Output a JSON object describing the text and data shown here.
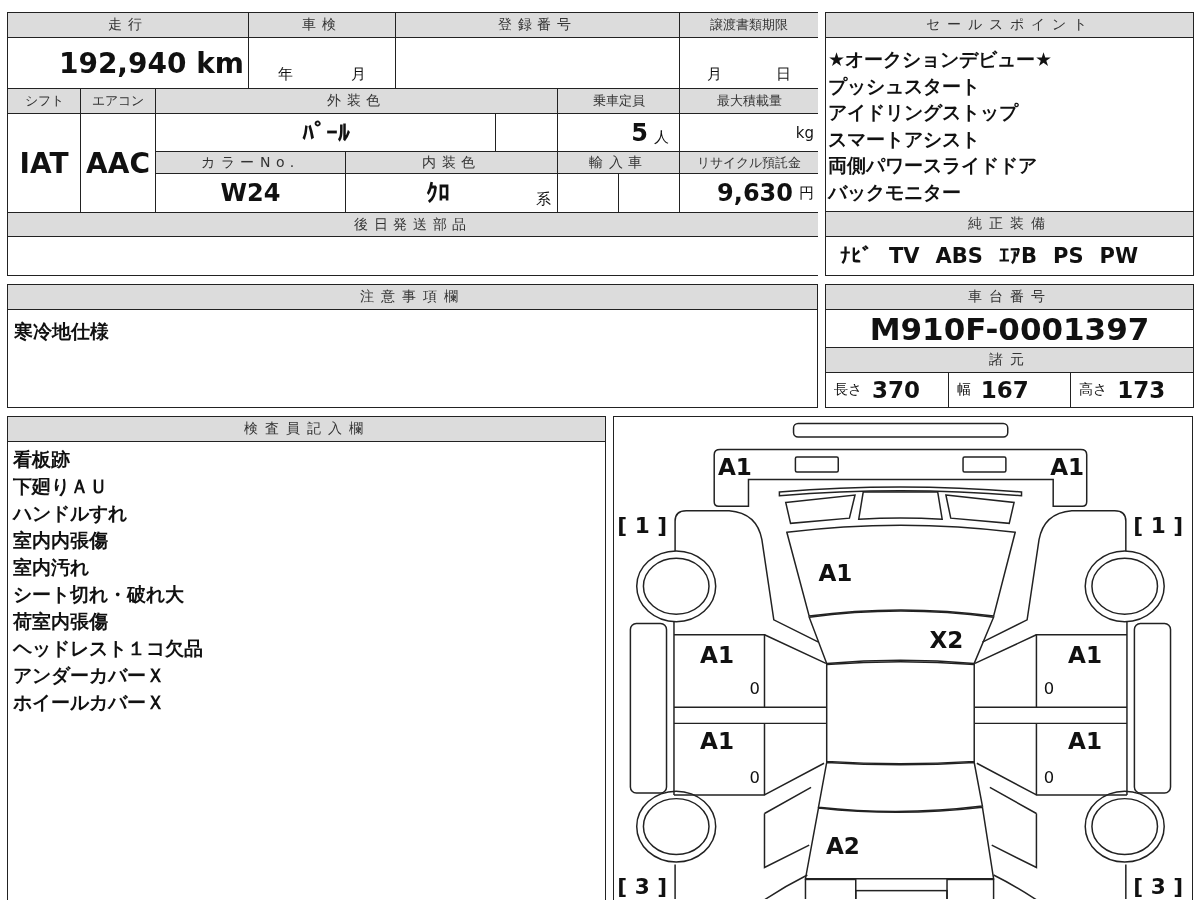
{
  "mileage": {
    "label": "走行",
    "value": "192,940 km"
  },
  "inspection": {
    "label": "車検",
    "year": "年",
    "month": "月"
  },
  "registration": {
    "label": "登録番号"
  },
  "transfer_deadline": {
    "label": "譲渡書類期限",
    "month": "月",
    "day": "日"
  },
  "shift": {
    "label": "シフト",
    "value": "IAT"
  },
  "aircon": {
    "label": "エアコン",
    "value": "AAC"
  },
  "exterior_color": {
    "label": "外装色",
    "value": "ﾊﾟｰﾙ"
  },
  "capacity": {
    "label": "乗車定員",
    "value": "5",
    "unit": "人"
  },
  "max_load": {
    "label": "最大積載量",
    "unit": "kg"
  },
  "color_no": {
    "label": "カラーNo.",
    "value": "W24"
  },
  "interior_color": {
    "label": "内装色",
    "value": "ｸﾛ",
    "suffix": "系"
  },
  "import": {
    "label": "輸入車"
  },
  "recycle_fee": {
    "label": "リサイクル預託金",
    "value": "9,630",
    "unit": "円"
  },
  "later_parts": {
    "label": "後日発送部品"
  },
  "sales_points": {
    "label": "セールスポイント",
    "items": [
      "★オークションデビュー★",
      "プッシュスタート",
      "アイドリングストップ",
      "スマートアシスト",
      "両側パワースライドドア",
      "バックモニター"
    ]
  },
  "equipment": {
    "label": "純正装備",
    "items": [
      "ﾅﾋﾞ",
      "TV",
      "ABS",
      "ｴｱB",
      "PS",
      "PW"
    ]
  },
  "chassis_number": {
    "label": "車台番号",
    "value": "M910F-0001397"
  },
  "specs": {
    "label": "諸元",
    "items": [
      {
        "label": "長さ",
        "value": "370"
      },
      {
        "label": "幅",
        "value": "167"
      },
      {
        "label": "高さ",
        "value": "173"
      }
    ]
  },
  "caution": {
    "label": "注意事項欄",
    "items": [
      "寒冷地仕様"
    ]
  },
  "inspector_notes": {
    "label": "検査員記入欄",
    "items": [
      "看板跡",
      "下廻りＡＵ",
      "ハンドルすれ",
      "室内内張傷",
      "室内汚れ",
      "シート切れ・破れ大",
      "荷室内張傷",
      "ヘッドレスト１コ欠品",
      "アンダーカバーＸ",
      "ホイールカバーＸ"
    ]
  },
  "diagram": {
    "marks": [
      "A1",
      "A1",
      "A1",
      "X2",
      "A1",
      "A1",
      "A1",
      "A1",
      "A2"
    ],
    "small_marks": [
      "0",
      "0",
      "0",
      "0"
    ],
    "corner_labels": [
      "[ 1 ]",
      "[ 1 ]",
      "[ 3 ]",
      "[ 3 ]"
    ]
  }
}
